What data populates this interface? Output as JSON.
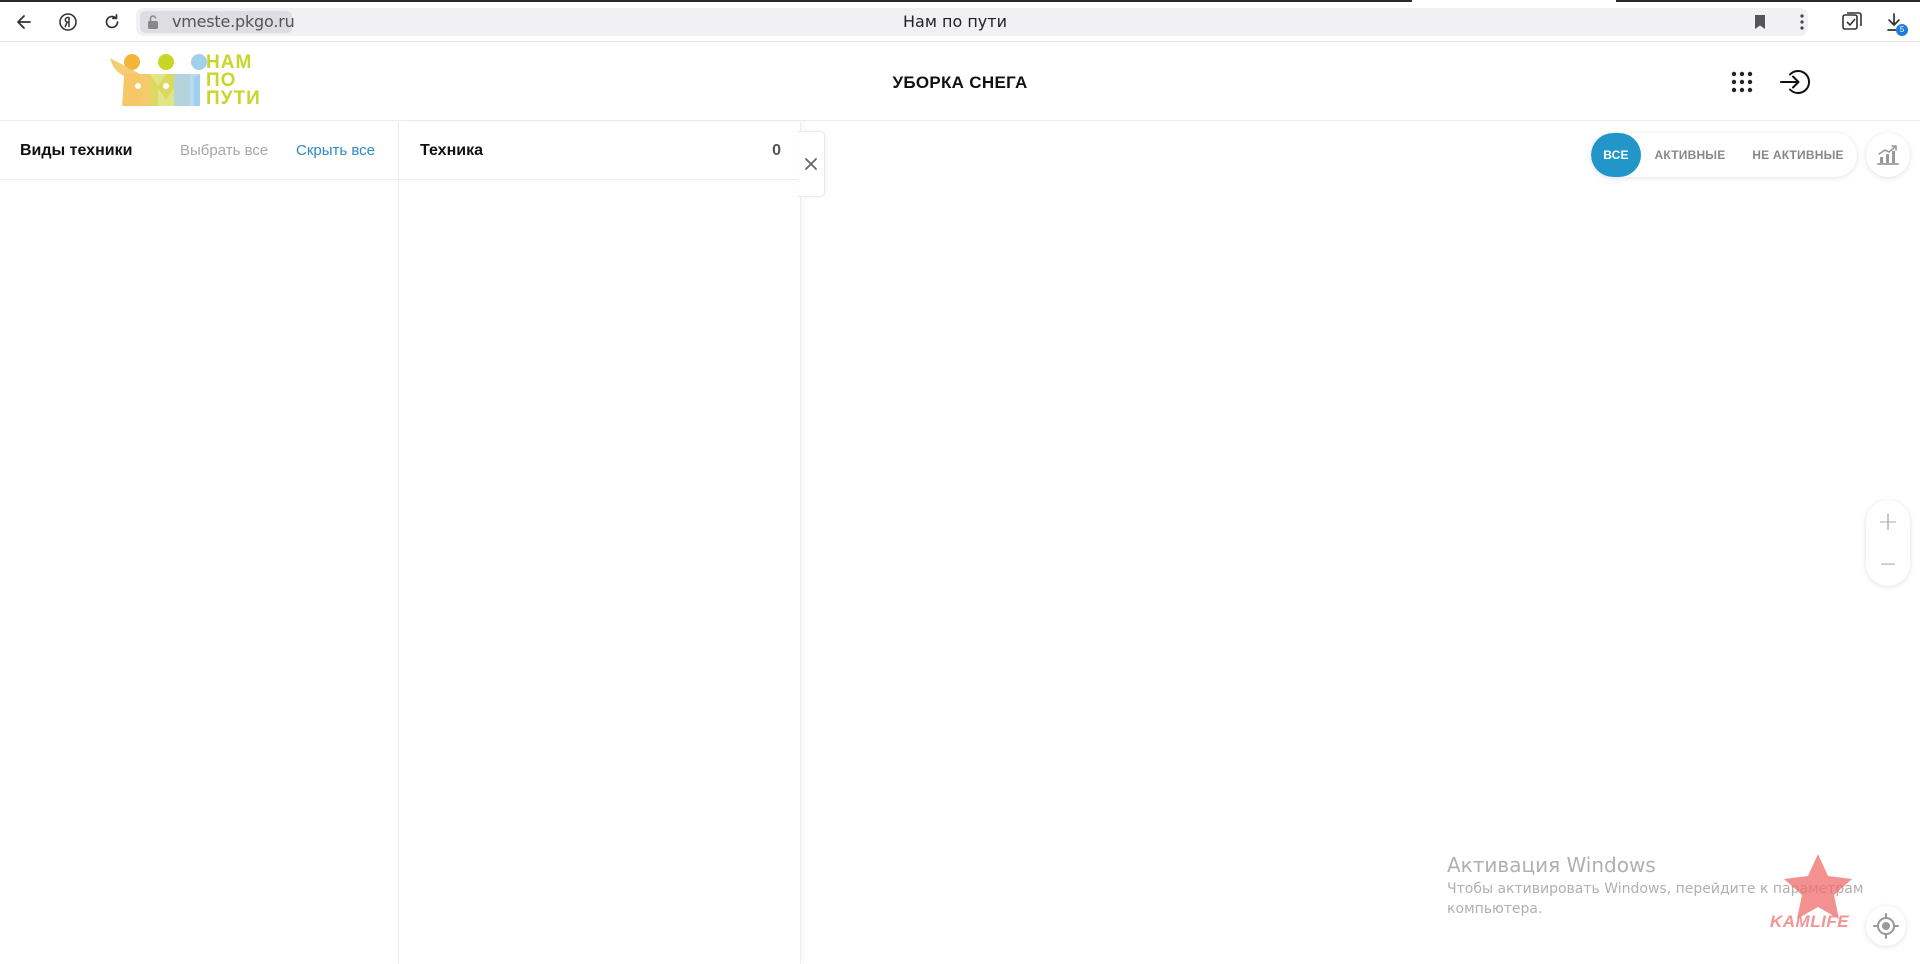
{
  "browser": {
    "url": "vmeste.pkgo.ru",
    "tab_title": "Нам по пути",
    "download_count": "5"
  },
  "header": {
    "logo_lines": [
      "НАМ",
      "ПО",
      "ПУТИ"
    ],
    "title": "УБОРКА СНЕГА"
  },
  "types_panel": {
    "title": "Виды техники",
    "select_all": "Выбрать все",
    "hide_all": "Скрыть все"
  },
  "equipment_panel": {
    "title": "Техника",
    "count": "0"
  },
  "filter": {
    "all": "ВСЕ",
    "active": "АКТИВНЫЕ",
    "inactive": "НЕ АКТИВНЫЕ",
    "selected": "ВСЕ"
  },
  "zoom": {
    "in": "+",
    "out": "−"
  },
  "watermark": {
    "title": "Активация Windows",
    "line1": "Чтобы активировать Windows, перейдите к параметрам",
    "line2": "компьютера.",
    "brand": "KAMLIFE"
  },
  "colors": {
    "accent": "#2296c9",
    "link": "#2a8cc4",
    "logo_green": "#c8d62a",
    "logo_orange": "#f2b53a",
    "logo_blue": "#9fd0ec"
  }
}
